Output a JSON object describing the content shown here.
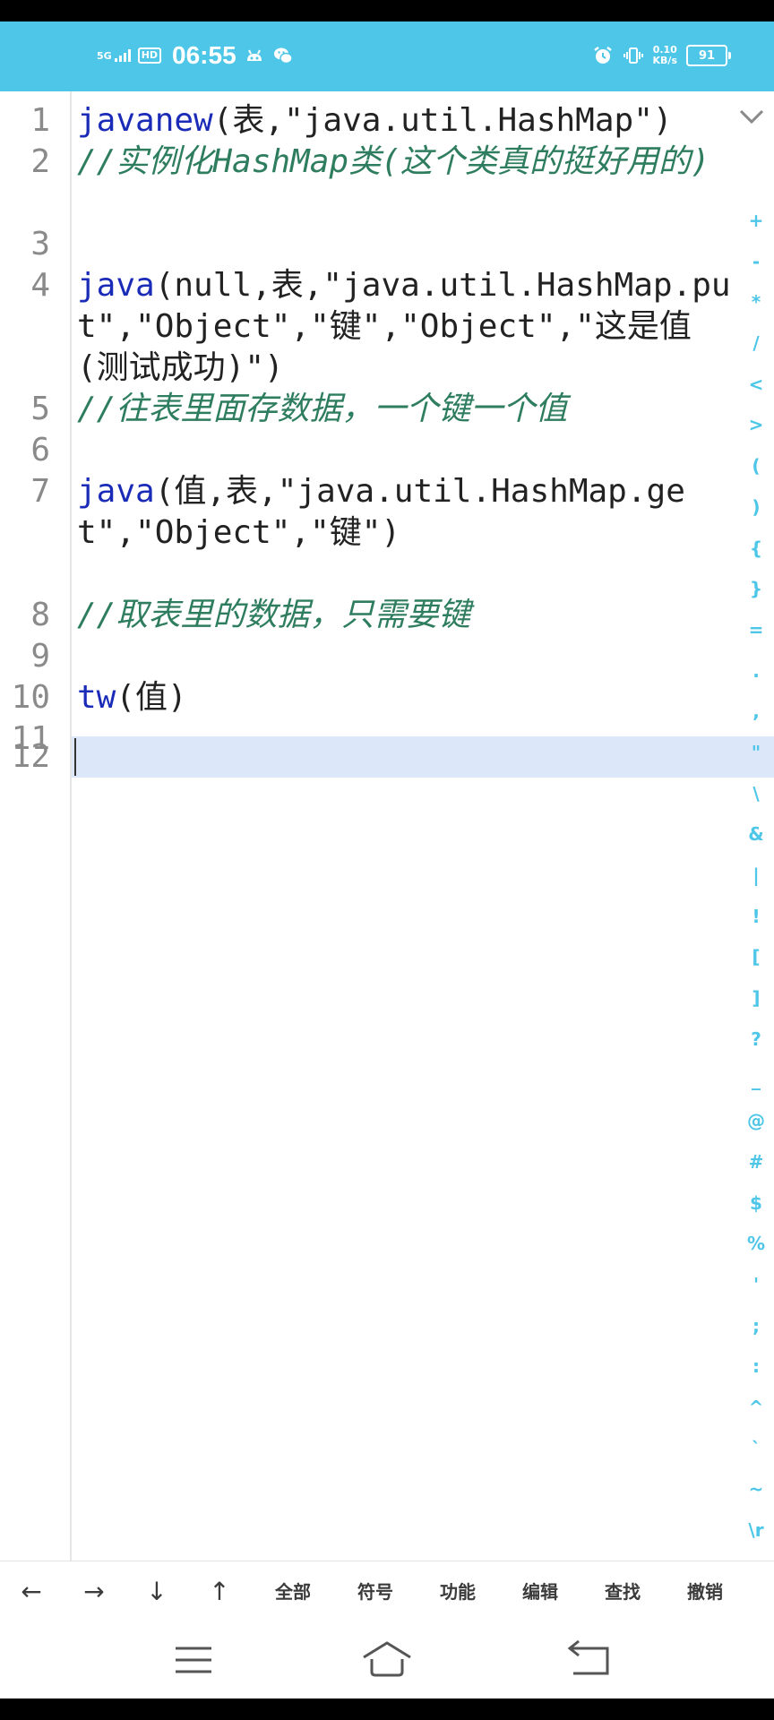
{
  "status_bar": {
    "network": "5G",
    "hd": "HD",
    "time": "06:55",
    "speed_value": "0.10",
    "speed_unit": "KB/s",
    "battery": "91"
  },
  "editor": {
    "lines": [
      {
        "num": "1",
        "segments": [
          {
            "t": "javanew",
            "c": "kw"
          },
          {
            "t": "(表,\"java.util.HashMap\")",
            "c": ""
          }
        ]
      },
      {
        "num": "2",
        "segments": [
          {
            "t": "//实例化HashMap类(这个类真的挺好用的)",
            "c": "cm"
          }
        ]
      },
      {
        "num": "3",
        "segments": []
      },
      {
        "num": "4",
        "segments": [
          {
            "t": "java",
            "c": "kw"
          },
          {
            "t": "(null,表,\"java.util.HashMap.put\",\"Object\",\"键\",\"Object\",\"这是值(测试成功)\")",
            "c": ""
          }
        ]
      },
      {
        "num": "5",
        "segments": [
          {
            "t": "//往表里面存数据，一个键一个值",
            "c": "cm"
          }
        ]
      },
      {
        "num": "6",
        "segments": []
      },
      {
        "num": "7",
        "segments": [
          {
            "t": "java",
            "c": "kw"
          },
          {
            "t": "(值,表,\"java.util.HashMap.get\",\"Object\",\"键\")",
            "c": ""
          }
        ]
      },
      {
        "num": "8",
        "segments": [
          {
            "t": "//取表里的数据，只需要键",
            "c": "cm"
          }
        ]
      },
      {
        "num": "9",
        "segments": []
      },
      {
        "num": "10",
        "segments": [
          {
            "t": "tw",
            "c": "kw"
          },
          {
            "t": "(值)",
            "c": ""
          }
        ]
      },
      {
        "num": "11",
        "segments": []
      },
      {
        "num": "12",
        "segments": []
      }
    ],
    "current_line": 12,
    "fold_icon": "chevron-down-icon"
  },
  "symbol_bar": [
    "+",
    "-",
    "*",
    "/",
    "<",
    ">",
    "(",
    ")",
    "{",
    "}",
    "=",
    ".",
    ",",
    "\"",
    "\\",
    "&",
    "|",
    "!",
    "[",
    "]",
    "?",
    "_",
    "@",
    "#",
    "$",
    "%",
    "'",
    ";",
    ":",
    "^",
    "`",
    "~",
    "\\r"
  ],
  "toolbar": {
    "items": [
      {
        "label": "←",
        "name": "arrow-left-button"
      },
      {
        "label": "→",
        "name": "arrow-right-button"
      },
      {
        "label": "↓",
        "name": "arrow-down-button"
      },
      {
        "label": "↑",
        "name": "arrow-up-button"
      },
      {
        "label": "全部",
        "name": "select-all-button"
      },
      {
        "label": "符号",
        "name": "symbols-button"
      },
      {
        "label": "功能",
        "name": "functions-button"
      },
      {
        "label": "编辑",
        "name": "edit-button"
      },
      {
        "label": "查找",
        "name": "find-button"
      },
      {
        "label": "撤销",
        "name": "undo-button"
      }
    ]
  },
  "navbar": {
    "menu": "menu-icon",
    "home": "home-icon",
    "back": "back-icon"
  },
  "colors": {
    "accent": "#4ec6e8",
    "keyword": "#1a2bb8",
    "comment": "#2e7d5e",
    "current_line": "#dce8fa"
  }
}
